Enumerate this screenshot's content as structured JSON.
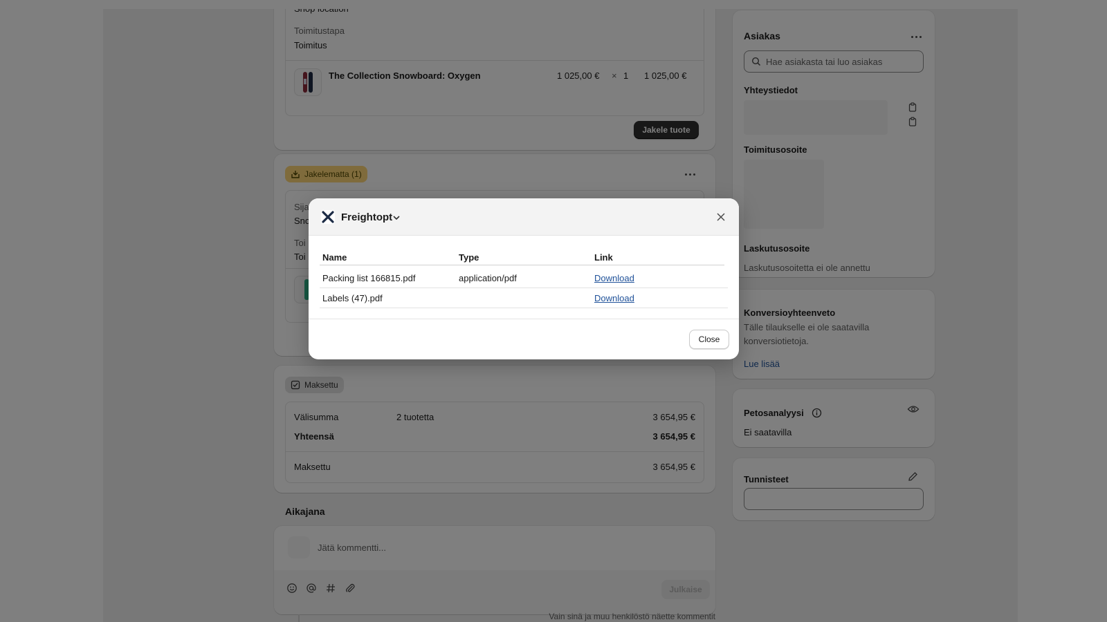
{
  "fulfilled_card": {
    "location_value": "Shop location",
    "shipping_method_label": "Toimitustapa",
    "shipping_method_value": "Toimitus",
    "product": {
      "name": "The Collection Snowboard: Oxygen",
      "unit_price": "1 025,00 €",
      "times": "×",
      "quantity": "1",
      "total": "1 025,00 €"
    },
    "button_label": "Jakele tuote"
  },
  "unfulfilled_card": {
    "badge": "Jakelematta (1)",
    "location_label_partial": "Sija",
    "location_value_partial": "Sno",
    "method_label_partial": "Toi",
    "method_value_partial": "Toi"
  },
  "payment_card": {
    "badge": "Maksettu",
    "subtotal_label": "Välisumma",
    "subtotal_items": "2 tuotetta",
    "subtotal_value": "3 654,95 €",
    "total_label": "Yhteensä",
    "total_value": "3 654,95 €",
    "paid_label": "Maksettu",
    "paid_value": "3 654,95 €"
  },
  "timeline": {
    "title": "Aikajana",
    "comment_placeholder": "Jätä kommentti...",
    "publish_label": "Julkaise",
    "footer_note": "Vain sinä ja muu henkilöstö näette kommentit"
  },
  "customer_card": {
    "title": "Asiakas",
    "search_placeholder": "Hae asiakasta tai luo asiakas",
    "contact_title": "Yhteystiedot",
    "shipping_address_title": "Toimitusosoite",
    "billing_title": "Laskutusosoite",
    "billing_empty": "Laskutusosoitetta ei ole annettu"
  },
  "conversion_card": {
    "title": "Konversioyhteenveto",
    "text": "Tälle tilaukselle ei ole saatavilla konversiotietoja.",
    "link": "Lue lisää"
  },
  "fraud_card": {
    "title": "Petosanalyysi",
    "status": "Ei saatavilla"
  },
  "tags_card": {
    "title": "Tunnisteet"
  },
  "modal": {
    "app_name": "Freightopt",
    "columns": [
      "Name",
      "Type",
      "Link"
    ],
    "rows": [
      {
        "name": "Packing list 166815.pdf",
        "type": "application/pdf",
        "link": "Download"
      },
      {
        "name": "Labels (47).pdf",
        "type": "",
        "link": "Download"
      }
    ],
    "close_label": "Close"
  },
  "colors": {
    "unfulfilled_badge_bg": "#ffd679",
    "link": "#1f5199",
    "primary_button": "#303030"
  }
}
